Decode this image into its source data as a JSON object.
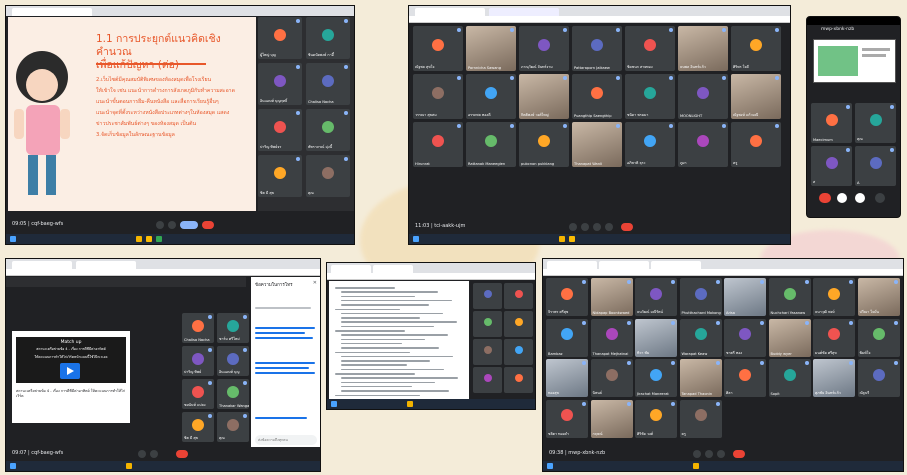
{
  "slide": {
    "heading": "1.1 การประยุกต์แนวคิดเชิงคำนวณ\nเพื่อแก้ปัญหา (ต่อ)",
    "body": "2.เว็บไซต์มีคุณสมบัติพิเศษของห้องสมุดเพื่อโรงเรียน\nให้เข้าใจ เช่น แนะนำการดำรงการสังเกตภูมิกับทำความสะอาด\nแนะนำขั้นตอนการยืม-คืนหนังสือ และสื่อการเรียนรู้อื่นๆ\nแนะนำจุดที่ตั้งระหว่างหนังสือประเภทต่างๆในห้องสมุด แสดง\nข่าวประชาสัมพันธ์ต่างๆ ของห้องสมุด เป็นต้น\n3.จัดเก็บข้อมูลในลักษณะฐานข้อมูล",
    "accent_color": "#e8572a",
    "bg_color": "#fbeee4"
  },
  "meet_code_1": "09:05 | cqf-baeg-wfs",
  "meet_code_2": "11:03 | tci-aakk-ujm",
  "meet_code_3": "09:07 | cqf-baeg-wfs",
  "meet_code_4": "09:38 | mwp-xbnk-nzb",
  "phone_title": "mwp-xbnk-nzb",
  "chat": {
    "title": "ข้อความในการโทร",
    "input_placeholder": "ส่งข้อความถึงทุกคน"
  },
  "quiz": {
    "line1": "Match up",
    "line2": "สถานะเครือข่ายข้อ 4 - เรื่อง การดีซีมีค่าอาทิตย์",
    "line3": "ให้คะแนนการทำให้ไก่เวิร์คหน้าเเบบนี้ใช้ไป๊กเวเอจ",
    "caption": "สถานะเครือข่ายข้อ 4 - เรื่อง การดีซีมีค่าอาทิตย์ ให้คะแนนการทำให้ไก่เวิร์ค"
  },
  "grid1_names": [
    "ผู้ใหญ่ บุญ",
    "ชินดนัยพงษ์ กาอึ้",
    "อินแอนท์ บุญฤทธิ์",
    "Chalisa Nacha",
    "ปาริญ ทิพย์จร",
    "พัชราภรณ์ มุ่งนี้",
    "ชิต มี สุข",
    "คุณ"
  ],
  "grid2_names": [
    "ณัฐพล สุขใจ",
    "Pornnicha Sawang",
    "ภาณุวัฒน์ จันทร์งาม",
    "Pattaraporn Jaikaew",
    "ชิดชนก สายทอง",
    "ธนพล อินทร์แก้ว",
    "ศิริพร ใจดี",
    "วรรณา สุขสม",
    "อรรถพล ทองดี",
    "กิตติพงษ์ วงศ์ใหญ่",
    "Puangthip Saengthip",
    "ชนิดา พรมมา",
    "MOONLIGHT",
    "ณัฐพงษ์ แก้วมณี",
    "Hirunrat",
    "Rattanak Maneeglen",
    "pubcnon pukklang",
    "Thanapat Wanli",
    "อภิชาติ ธุระ",
    "ภูผา",
    "ครู"
  ],
  "grid3_names": [
    "จิราพร ศรีสุข",
    "Nidapap Boonkwaed",
    "ธนวัฒน์ มณีรัตน์",
    "Phutthachard Mokong",
    "Arisa",
    "Nuchchari Yasanaw",
    "ธนาวุฒิ พงษ์",
    "ปวีณา ใจมั่น",
    "Bambaz",
    "Thanapat Mejhatnai",
    "ทิวา ชัย",
    "Warapat Keaw",
    "ชาตรี ทอง",
    "Buddy wyer",
    "มนต์ชัย ศรีสุข",
    "พิมพ์ใจ",
    "ทองสุข",
    "นิพนธ์",
    "Jirachat Maneerat",
    "Tanapad Thaonin",
    "ศิลา",
    "Sopit",
    "ศุภชัย อินทร์แก้ว",
    "ณัฐนรี",
    "ชลิตา ทองคำ",
    "กฤษณ์",
    "ศิริชัย วงศ์",
    "ครู"
  ],
  "grid4_names": [
    "Chalisa Nacha",
    "ชาร์ม ศรีใหม่",
    "ปาริญ ทิพย์",
    "อินแอนท์ บุญ",
    "ชยนันท์ แปลง",
    "Thanakar Wangam",
    "ชิต มี สุข",
    "คุณ"
  ],
  "grid5_names": [
    "Maecimum",
    "คุณ",
    "ส",
    "A"
  ]
}
